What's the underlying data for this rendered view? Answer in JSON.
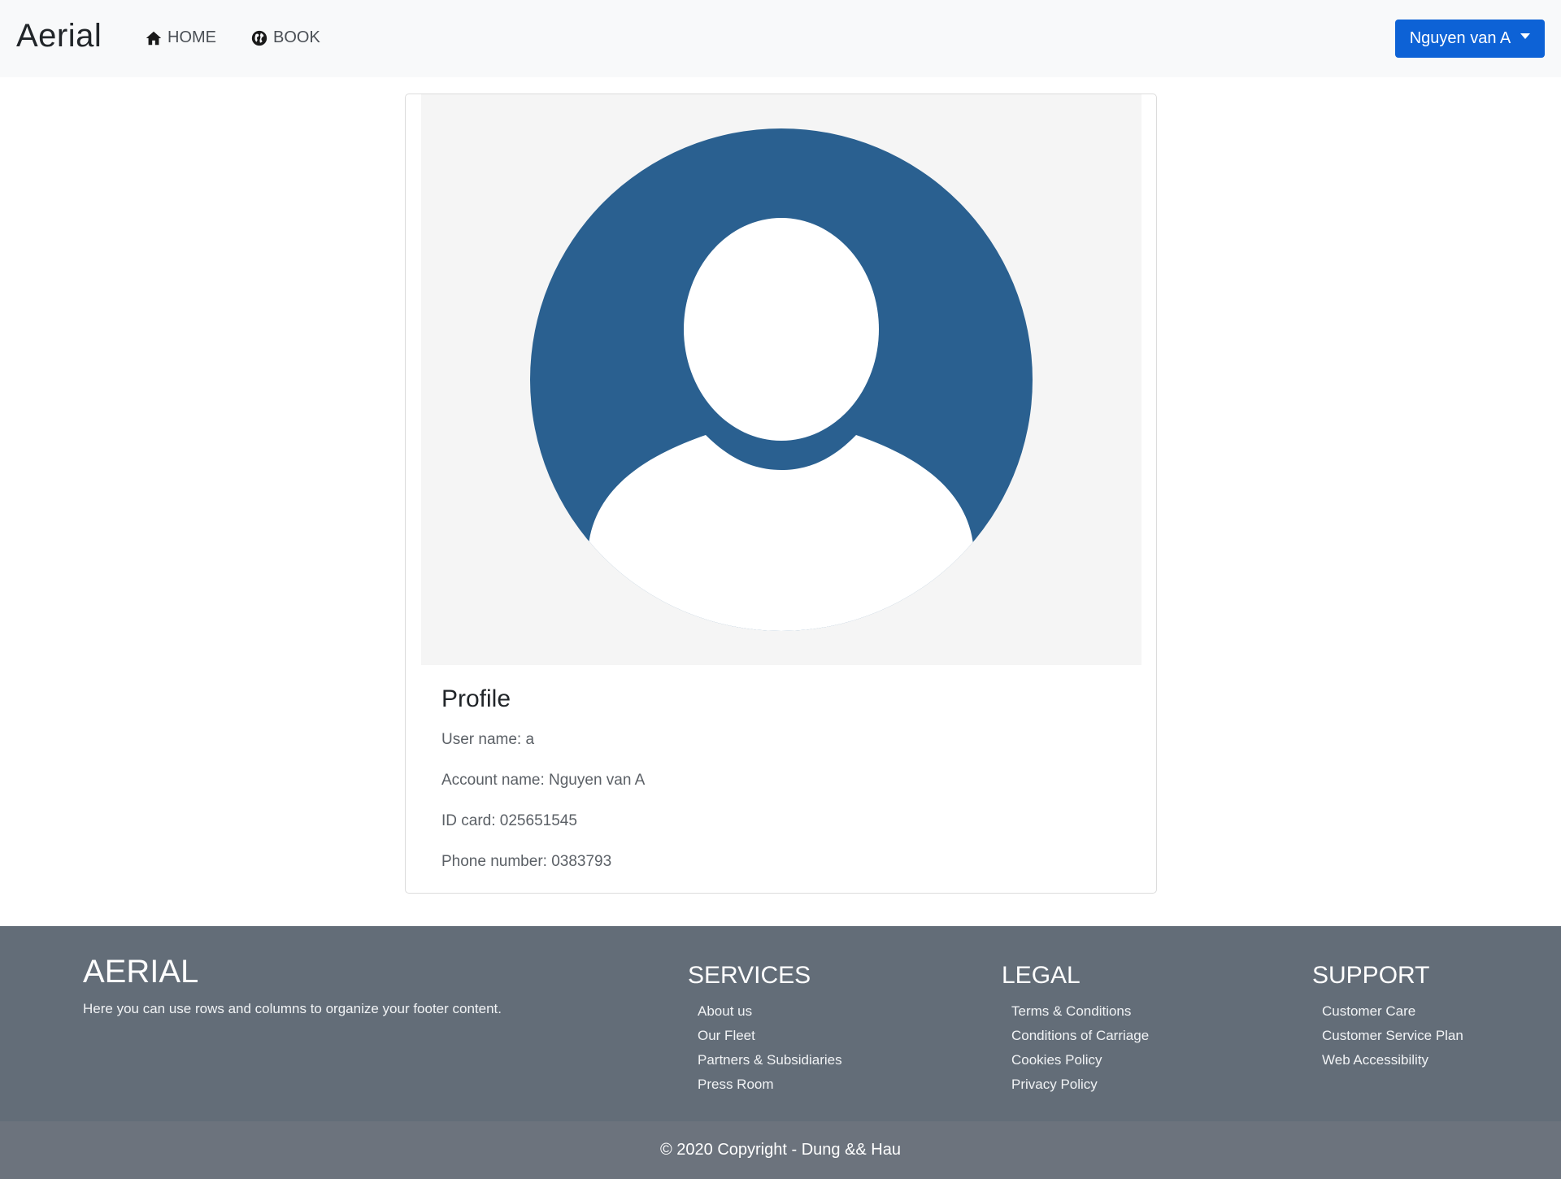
{
  "navbar": {
    "brand": "Aerial",
    "home_label": "HOME",
    "book_label": "BOOK",
    "user_button": "Nguyen van A",
    "home_icon": "home-icon",
    "book_icon": "globe-icon"
  },
  "card": {
    "avatar_icon": "user-avatar-icon",
    "avatar_color": "#2a6090",
    "title": "Profile",
    "lines": [
      "User name: a",
      "Account name: Nguyen van A",
      "ID card: 025651545",
      "Phone number: 0383793"
    ]
  },
  "footer": {
    "brand": "AERIAL",
    "description": "Here you can use rows and columns to organize your footer content.",
    "columns": [
      {
        "title": "SERVICES",
        "links": [
          "About us",
          "Our Fleet",
          "Partners & Subsidiaries",
          "Press Room"
        ]
      },
      {
        "title": "LEGAL",
        "links": [
          "Terms & Conditions",
          "Conditions of Carriage",
          "Cookies Policy",
          "Privacy Policy"
        ]
      },
      {
        "title": "SUPPORT",
        "links": [
          "Customer Care",
          "Customer Service Plan",
          "Web Accessibility"
        ]
      }
    ],
    "copyright": "© 2020 Copyright - Dung && Hau",
    "background": "#636d78"
  },
  "colors": {
    "primary_button": "#0d62d6",
    "navbar_bg": "#f8f9fa"
  }
}
